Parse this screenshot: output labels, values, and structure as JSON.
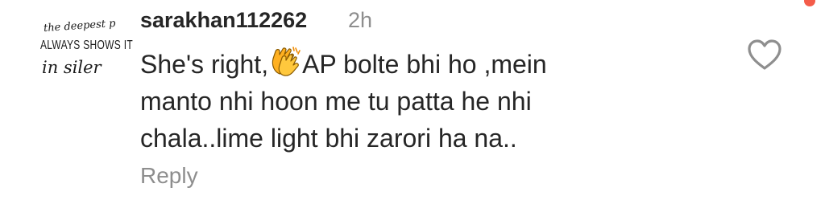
{
  "comment": {
    "avatar": {
      "text_line1": "the deepest p",
      "text_line2": "ALWAYS SHOWS IT",
      "text_line3": "in siler"
    },
    "username": "sarakhan112262",
    "timestamp": "2h",
    "text_line1_before": "She's right,",
    "emoji": "clapping-hands",
    "text_line1_after": "AP bolte bhi ho ,mein",
    "text_line2": "manto nhi hoon me tu patta he nhi",
    "text_line3": "chala..lime light bhi zarori ha na..",
    "reply_label": "Reply",
    "like_icon": "heart-outline-icon"
  },
  "colors": {
    "username": "#262626",
    "muted": "#8e8e8e",
    "notification_dot": "#f45c4a"
  }
}
